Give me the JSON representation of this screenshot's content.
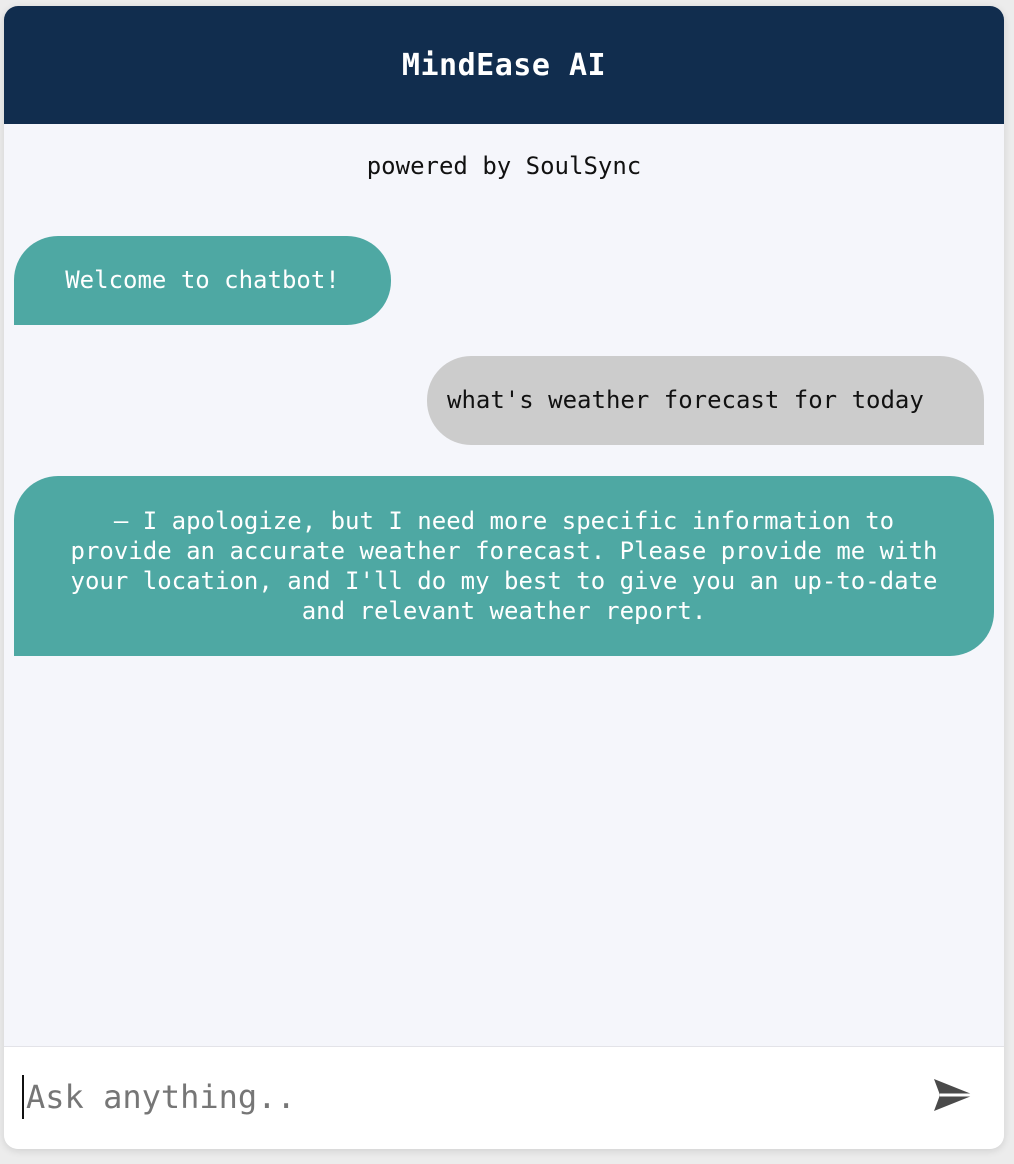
{
  "header": {
    "title": "MindEase AI",
    "subtitle": "powered by SoulSync"
  },
  "messages": [
    {
      "sender": "bot",
      "text": "Welcome to chatbot!"
    },
    {
      "sender": "user",
      "text": "what's weather forecast for today"
    },
    {
      "sender": "bot",
      "text": "— I apologize, but I need more specific information to provide an accurate weather forecast. Please provide me with your location, and I'll do my best to give you an up-to-date and relevant weather report."
    }
  ],
  "composer": {
    "placeholder": "Ask anything..",
    "value": "",
    "send_icon": "send-icon"
  },
  "colors": {
    "header_bg": "#112d4e",
    "bot_bubble": "#4ea8a3",
    "user_bubble": "#cccccc",
    "chat_bg": "#f5f6fb"
  }
}
